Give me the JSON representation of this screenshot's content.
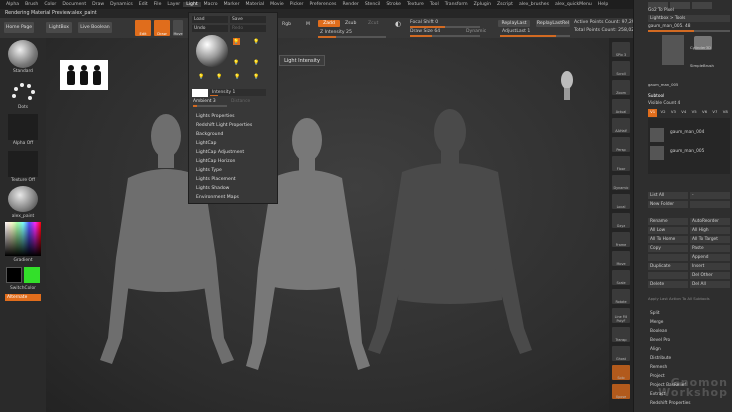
{
  "menu": [
    "Alpha",
    "Brush",
    "Color",
    "Document",
    "Draw",
    "Dynamics",
    "Edit",
    "File",
    "Layer",
    "Light",
    "Macro",
    "Marker",
    "Material",
    "Movie",
    "Picker",
    "Preferences",
    "Render",
    "Stencil",
    "Stroke",
    "Texture",
    "Tool",
    "Transform",
    "Zplugin",
    "Zscript",
    "alex_brushes",
    "alex_quickMenu",
    "Help"
  ],
  "active_menu": "Light",
  "title": "Rendering Material Preview:alex_paint",
  "toolbar": {
    "home": "Home Page",
    "lightbox": "LightBox",
    "liveboolean": "Live Boolean",
    "edit": "Edit",
    "draw": "Draw",
    "move": "Move",
    "scale": "Scale",
    "rotate": "Rotate",
    "rgb": "Rgb",
    "m": "M",
    "zadd": "Zadd",
    "zsub": "Zsub",
    "zcut": "Zcut",
    "rgb_intensity": "Rgb Intensity",
    "z_intensity": "Z Intensity 25",
    "focal_shift": "Focal Shift 0",
    "draw_size": "Draw Size 64",
    "dynamic": "Dynamic",
    "replay_last": "ReplayLast",
    "replay_last_rel": "ReplayLastRel",
    "adjust_last": "AdjustLast 1",
    "active_points": "Active Points Count: 97,29",
    "total_points": "Total Points Count: 258,02"
  },
  "left_shelf": {
    "brush": "Standard",
    "stroke": "Dots",
    "alpha": "Alpha Off",
    "texture": "Texture Off",
    "material": "alex_paint",
    "gradient": "Gradient",
    "switch_color": "SwitchColor",
    "alternate": "Alternate"
  },
  "light_menu": {
    "load": "Load",
    "save": "Save",
    "undo": "Undo",
    "redo": "Redo",
    "intensity": "Intensity 1",
    "ambient": "Ambient 3",
    "distance": "Distance",
    "items": [
      "Lights Properties",
      "Redshift Light Properties",
      "Background",
      "LightCap",
      "LightCap Adjustment",
      "LightCap Horizon",
      "Lights Type",
      "Lights Placement",
      "Lights Shadow",
      "Environment Maps"
    ]
  },
  "tooltip": "Light Intensity",
  "right_shelf": [
    "SPix 3",
    "Scroll",
    "Zoom",
    "Actual",
    "AAHalf",
    "Persp",
    "Floor",
    "Dynamic",
    "Local",
    "Gxyz",
    "Frame",
    "Move",
    "Scale",
    "Rotate",
    "Line Fill PolyF",
    "Transp",
    "Ghost",
    "Solo",
    "Xpose"
  ],
  "right_panel": {
    "top_buttons": [
      "Go2 To Pixel",
      "Lightbox > Tools"
    ],
    "tool_name": "gaum_man_005. 48",
    "tools": [
      "Cylinder3D",
      "SimpleBrush",
      "gaum_man_005"
    ],
    "subtool_header": "Subtool",
    "visible_count": "Visible Count 4",
    "v_tabs": [
      "V1",
      "V2",
      "V3",
      "V4",
      "V5",
      "V6",
      "V7",
      "V8"
    ],
    "subtools": [
      "gaum_man_004",
      "gaum_man_005"
    ],
    "buttons_a": [
      [
        "List All",
        "-"
      ],
      [
        "New Folder",
        ""
      ]
    ],
    "buttons_b": [
      [
        "Rename",
        "AutoReorder"
      ],
      [
        "All Low",
        "All High"
      ],
      [
        "All To Home",
        "All To Target"
      ],
      [
        "Copy",
        "Paste"
      ],
      [
        "",
        "Append"
      ],
      [
        "Duplicate",
        "Insert"
      ],
      [
        "",
        "Del Other"
      ],
      [
        "Delete",
        "Del All"
      ]
    ],
    "apply_note": "Apply Last Action To All Subtools",
    "menu_items": [
      "Split",
      "Merge",
      "Boolean",
      "Bevel Pro",
      "Align",
      "Distribute",
      "Remesh",
      "Project",
      "Project BasRelief",
      "Extract",
      "Redshift Properties"
    ]
  },
  "colors": {
    "accent": "#e06d1c",
    "menubar": "#1e1e1e",
    "panel": "#2e2e2e",
    "viewport": "#3a3a3a"
  },
  "watermark": "Gnomon Workshop"
}
